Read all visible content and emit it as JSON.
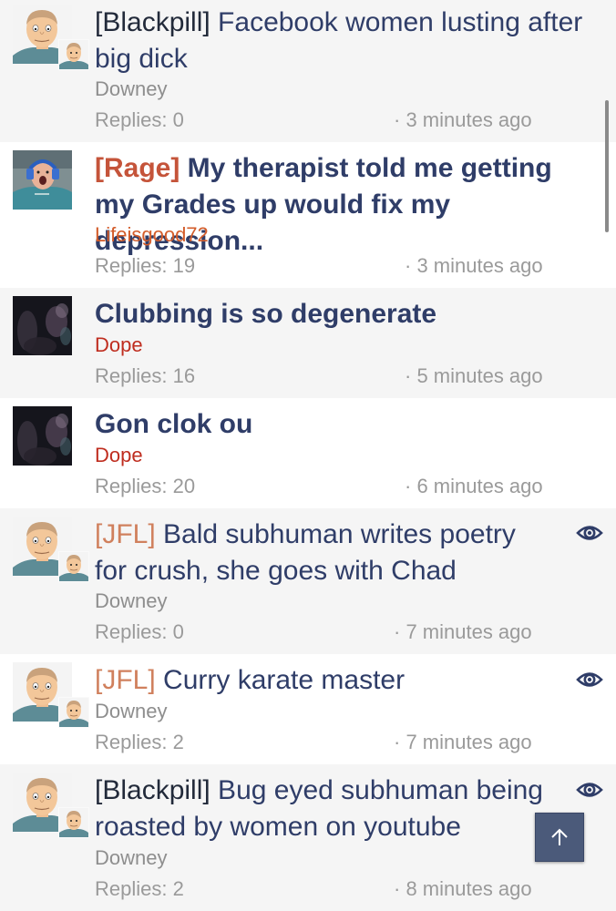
{
  "threads": [
    {
      "prefix": "[Blackpill]",
      "title": " Facebook women lusting after big dick",
      "author": "Downey",
      "replies": "Replies: 0",
      "time": "· 3 minutes ago"
    },
    {
      "prefix": "[Rage]",
      "title": " My therapist told me getting my Grades up would fix my depression...",
      "author": "Lifeisgood72",
      "replies": "Replies: 19",
      "time": "· 3 minutes ago"
    },
    {
      "prefix": "",
      "title": "Clubbing is so degenerate",
      "author": "Dope",
      "replies": "Replies: 16",
      "time": "· 5 minutes ago"
    },
    {
      "prefix": "",
      "title": "Gon clok ou",
      "author": "Dope",
      "replies": "Replies: 20",
      "time": "· 6 minutes ago"
    },
    {
      "prefix": "[JFL]",
      "title": " Bald subhuman writes poetry for crush, she goes with Chad",
      "author": "Downey",
      "replies": "Replies: 0",
      "time": "· 7 minutes ago",
      "watched": true
    },
    {
      "prefix": "[JFL]",
      "title": " Curry karate master",
      "author": "Downey",
      "replies": "Replies: 2",
      "time": "· 7 minutes ago",
      "watched": true
    },
    {
      "prefix": "[Blackpill]",
      "title": " Bug eyed subhuman being roasted by women on youtube",
      "author": "Downey",
      "replies": "Replies: 2",
      "time": "· 8 minutes ago",
      "watched": true
    }
  ],
  "icons": {
    "watch": "eye-icon",
    "scroll_top": "arrow-up-icon"
  },
  "colors": {
    "title": "#2f3d68",
    "prefix_rage": "#c5543a",
    "prefix_jfl": "#d0805d",
    "author_red": "#bf2d1f",
    "author_orange": "#d35c2a",
    "meta": "#9a9a9a",
    "button": "#4b5a7a"
  }
}
